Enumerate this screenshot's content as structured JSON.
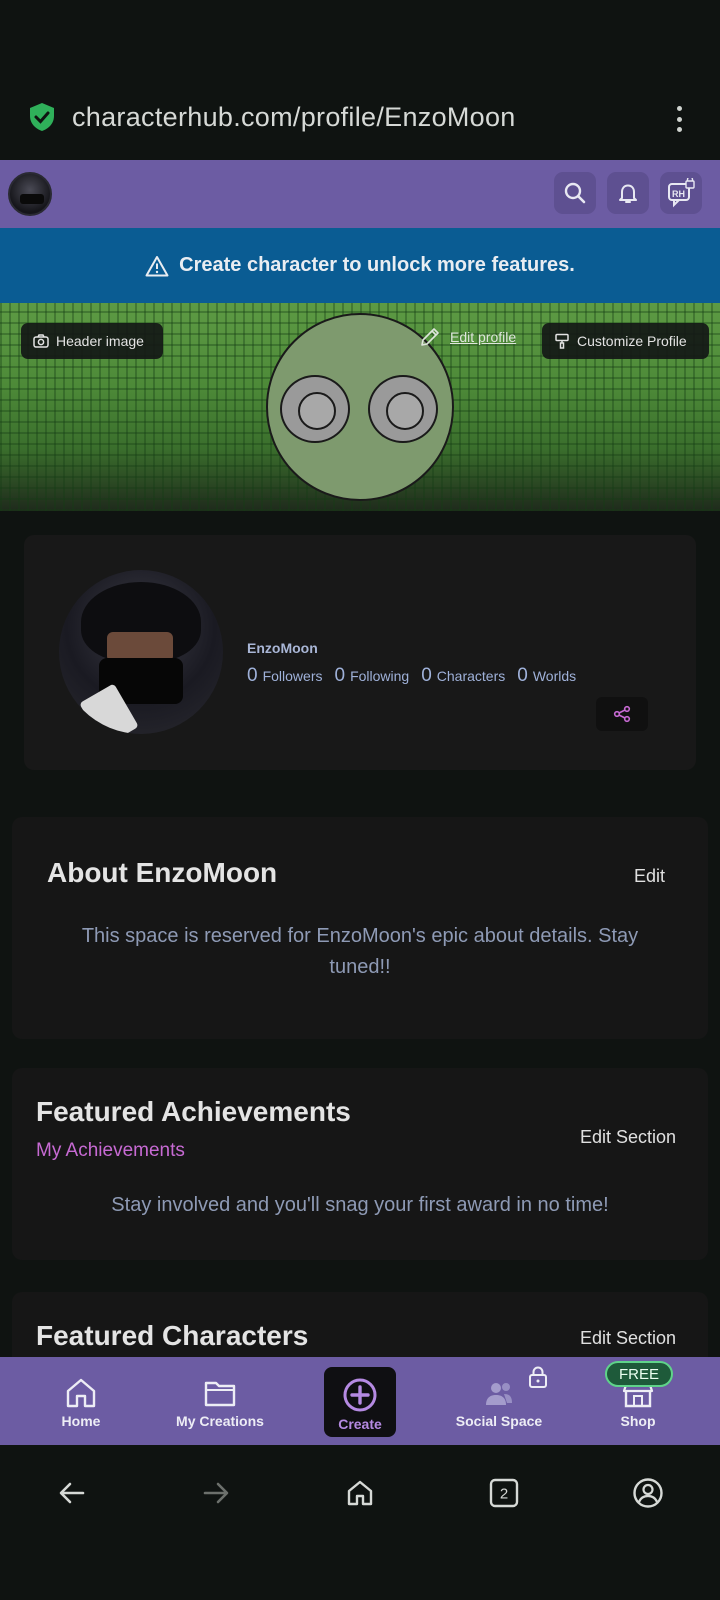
{
  "browser": {
    "url": "characterhub.com/profile/EnzoMoon",
    "tab_count": "2"
  },
  "topnav": {
    "notice_icon_text": "RH"
  },
  "banner": {
    "text": "Create character to unlock more features."
  },
  "header": {
    "header_image_label": "Header image",
    "edit_profile_label": "Edit profile",
    "customize_label": "Customize Profile"
  },
  "profile": {
    "username": "EnzoMoon",
    "stats": [
      {
        "value": "0",
        "label": "Followers"
      },
      {
        "value": "0",
        "label": "Following"
      },
      {
        "value": "0",
        "label": "Characters"
      },
      {
        "value": "0",
        "label": "Worlds"
      }
    ]
  },
  "about": {
    "title": "About EnzoMoon",
    "edit_label": "Edit",
    "body": "This space is reserved for EnzoMoon's epic about details. Stay tuned!!"
  },
  "achievements": {
    "title": "Featured Achievements",
    "edit_label": "Edit Section",
    "link": "My Achievements",
    "body": "Stay involved and you'll snag your first award in no time!"
  },
  "characters": {
    "title": "Featured Characters",
    "edit_label": "Edit Section"
  },
  "bottomnav": {
    "items": [
      {
        "label": "Home",
        "icon": "home-icon"
      },
      {
        "label": "My Creations",
        "icon": "folder-icon"
      },
      {
        "label": "Create",
        "icon": "plus-circle-icon"
      },
      {
        "label": "Social Space",
        "icon": "people-icon"
      },
      {
        "label": "Shop",
        "icon": "store-icon"
      }
    ],
    "free_badge": "FREE"
  },
  "colors": {
    "nav_purple": "#6c5ca3",
    "banner_blue": "#0a5c93",
    "accent_pink": "#c76ad3",
    "muted_text": "#8e9ab5"
  }
}
